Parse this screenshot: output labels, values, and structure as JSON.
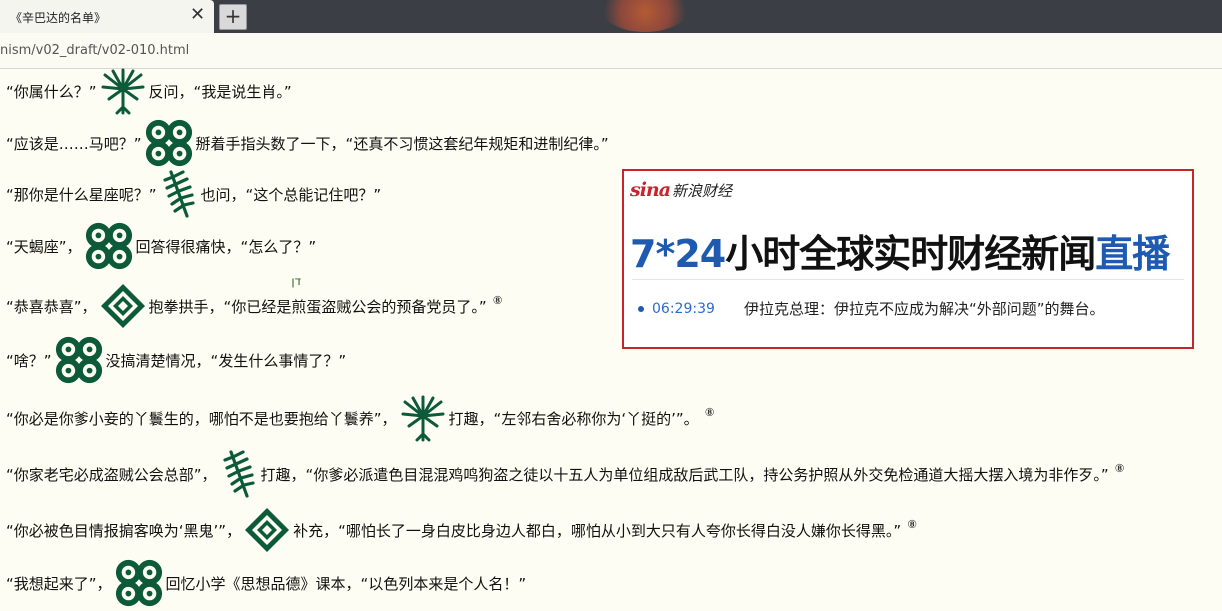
{
  "browser": {
    "tab_title": "《辛巴达的名单》",
    "close_glyph": "✕",
    "new_tab_glyph": "+",
    "address": "nism/v02_draft/v02-010.html"
  },
  "lines": [
    {
      "a": "“你属什么？”",
      "b": "反问，“我是说生肖。”"
    },
    {
      "a": "“应该是……马吧？”",
      "b": "掰着手指头数了一下，“还真不习惯这套纪年规矩和进制纪律。”"
    },
    {
      "a": "“那你是什么星座呢？”",
      "b": "也问，“这个总能记住吧？”"
    },
    {
      "a": "“天蝎座”，",
      "b": "回答得很痛快，“怎么了？”"
    },
    {
      "a": "“恭喜恭喜”，",
      "b1": "抱拳拱手，“你已经是",
      "b2": "煎蛋盗贼公会的预备党员了。”",
      "hebrew": "דן",
      "sup": "⑧"
    },
    {
      "a": "“啥？”",
      "b": "没搞清楚情况，“发生什么事情了？”"
    },
    {
      "a": "“你必是你爹小妾的丫鬟生的，哪怕不是也要抱给丫鬟养”，",
      "b": "打趣，“左邻右舍必称你为‘丫挺的’”。",
      "sup": "⑧"
    },
    {
      "a": "“你家老宅必成盗贼公会总部”，",
      "b": "打趣，“你爹必派遣色目混混鸡鸣狗盗之徒以十五人为单位组成敌后武工队，持公务护照从外交免检通道大摇大摆入境为非作歹。”",
      "sup": "⑧"
    },
    {
      "a": "“你必被色目情报掮客唤为‘黑鬼’”，",
      "b": "补充，“哪怕长了一身白皮比身边人都白，哪怕从小到大只有人夸你长得白没人嫌你长得黑。”",
      "sup": "⑧"
    },
    {
      "a": "“我想起来了”，",
      "b": "回忆小学《思想品德》课本，“以色列本来是个人名！”"
    }
  ],
  "icons": [
    "palm-tree-icon",
    "triple-ring-icon",
    "fern-leaf-icon",
    "triple-ring-icon",
    "nested-diamond-icon",
    "triple-ring-icon",
    "palm-tree-icon",
    "fern-leaf-icon",
    "nested-diamond-icon",
    "triple-ring-icon"
  ],
  "widget": {
    "brand_logo": "sina",
    "brand_name": "新浪财经",
    "headline_a": "7*24",
    "headline_b": "小时全球实时财经新闻",
    "headline_c": "直播",
    "news_time": "06:29:39",
    "news_text": "伊拉克总理：伊拉克不应成为解决“外部问题”的舞台。"
  },
  "colors": {
    "icon_green": "#0c5a3a",
    "sina_red": "#c7242b",
    "headline_blue": "#1e5ab0"
  }
}
